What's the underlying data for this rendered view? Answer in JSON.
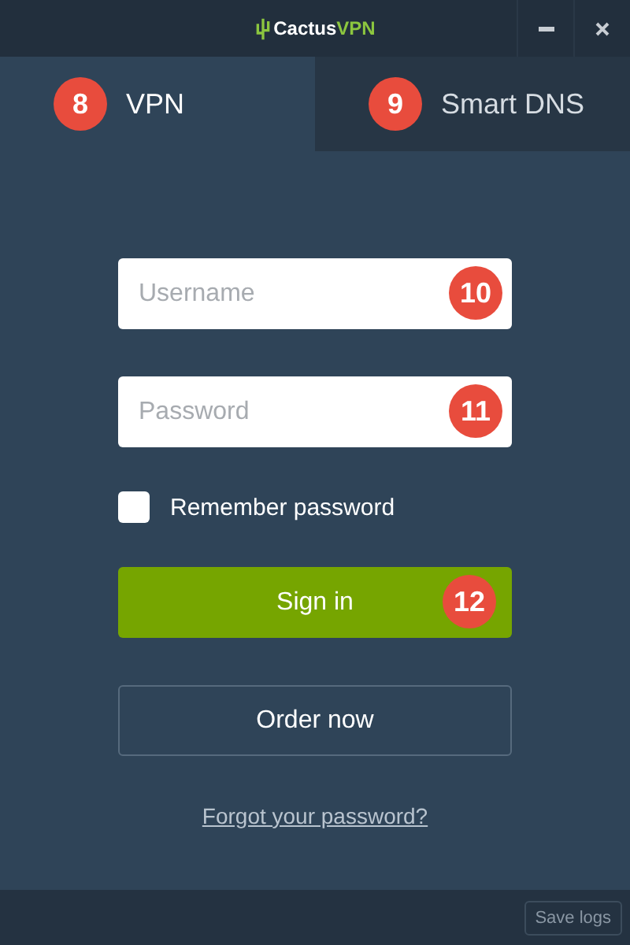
{
  "window": {
    "logo": {
      "name": "Cactus",
      "accent": "VPN"
    },
    "controls": [
      {
        "kind": "minimize"
      },
      {
        "kind": "close"
      }
    ]
  },
  "tabs": [
    {
      "label": "VPN",
      "badge": "8",
      "selected": true
    },
    {
      "label": "Smart DNS",
      "badge": "9",
      "selected": false
    }
  ],
  "form": {
    "username": {
      "placeholder": "Username",
      "badge": "10"
    },
    "password": {
      "placeholder": "Password",
      "badge": "11"
    },
    "remember": {
      "label": "Remember password",
      "checked": false
    },
    "sign_in": {
      "label": "Sign in",
      "badge": "12"
    },
    "order": {
      "label": "Order now"
    },
    "forgot": "Forgot your password?"
  },
  "status_bar": {
    "button": "Save logs"
  }
}
